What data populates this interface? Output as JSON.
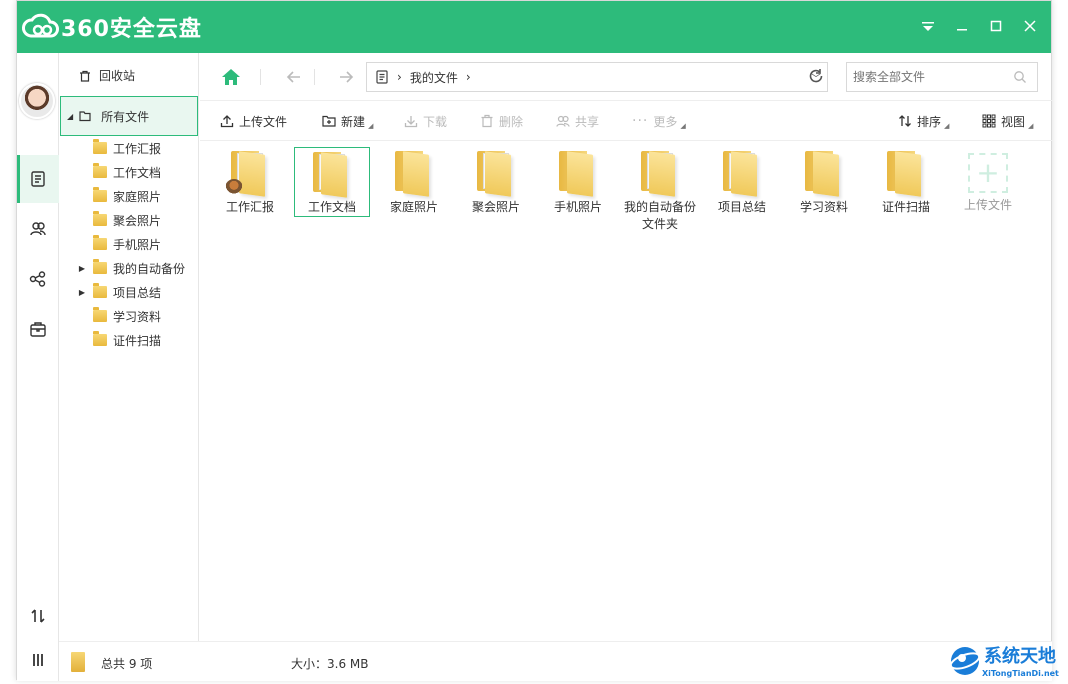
{
  "app": {
    "title": "360安全云盘",
    "brand_color": "#2dbb7b"
  },
  "window_controls": [
    "menu-icon",
    "minimize-icon",
    "maximize-icon",
    "close-icon"
  ],
  "tree": {
    "recycle": "回收站",
    "all_files": "所有文件",
    "folders": [
      {
        "label": "工作汇报",
        "expandable": false
      },
      {
        "label": "工作文档",
        "expandable": false
      },
      {
        "label": "家庭照片",
        "expandable": false
      },
      {
        "label": "聚会照片",
        "expandable": false
      },
      {
        "label": "手机照片",
        "expandable": false
      },
      {
        "label": "我的自动备份",
        "expandable": true
      },
      {
        "label": "项目总结",
        "expandable": true
      },
      {
        "label": "学习资料",
        "expandable": false
      },
      {
        "label": "证件扫描",
        "expandable": false
      }
    ]
  },
  "path": {
    "current": "我的文件"
  },
  "search": {
    "placeholder": "搜索全部文件"
  },
  "toolbar": {
    "upload": "上传文件",
    "new": "新建",
    "download": "下载",
    "delete": "删除",
    "share": "共享",
    "more": "更多",
    "sort": "排序",
    "view": "视图"
  },
  "files": [
    {
      "name": "工作汇报",
      "selected": false
    },
    {
      "name": "工作文档",
      "selected": true
    },
    {
      "name": "家庭照片",
      "selected": false
    },
    {
      "name": "聚会照片",
      "selected": false
    },
    {
      "name": "手机照片",
      "selected": false
    },
    {
      "name": "我的自动备份文件夹",
      "selected": false
    },
    {
      "name": "项目总结",
      "selected": false
    },
    {
      "name": "学习资料",
      "selected": false
    },
    {
      "name": "证件扫描",
      "selected": false
    }
  ],
  "upload_tile": "上传文件",
  "status": {
    "total": "总共 9 项",
    "size": "大小：3.6 MB"
  },
  "watermark": {
    "title": "系统天地",
    "sub": "XiTongTianDi.net"
  }
}
